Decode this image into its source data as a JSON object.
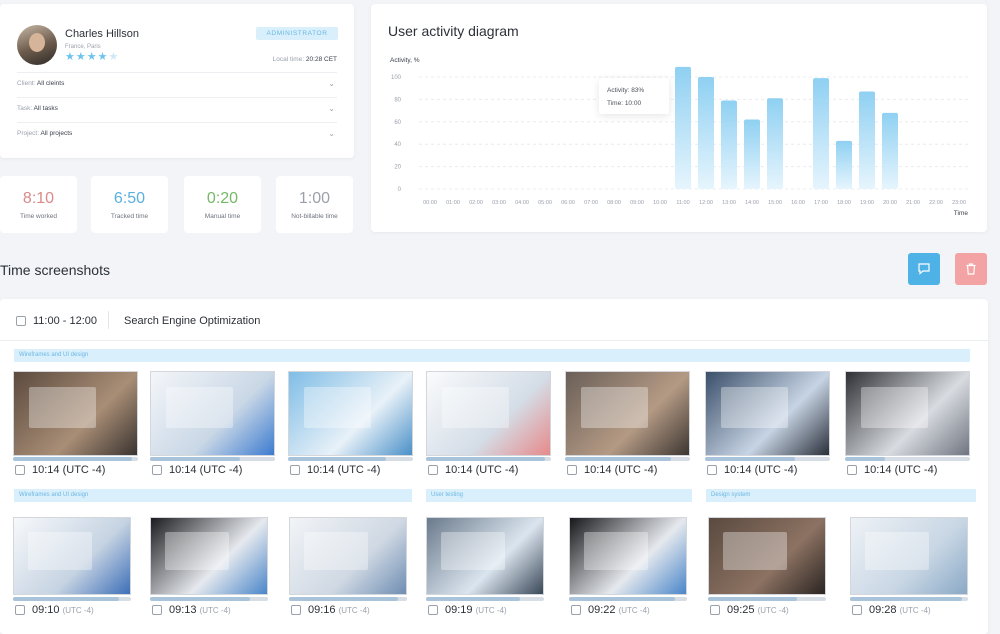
{
  "profile": {
    "name": "Charles Hillson",
    "location": "France, Paris",
    "rating": 4,
    "rating_max": 5,
    "badge": "ADMINISTRATOR",
    "local_time_label": "Local time:",
    "local_time_value": "20:28 CET",
    "filters": [
      {
        "label": "Client:",
        "value": "All cleints"
      },
      {
        "label": "Task:",
        "value": "All tasks"
      },
      {
        "label": "Project:",
        "value": "All projects"
      }
    ]
  },
  "stats": [
    {
      "value": "8:10",
      "label": "Time worked",
      "color": "#d98a8a"
    },
    {
      "value": "6:50",
      "label": "Tracked time",
      "color": "#5bb0dd"
    },
    {
      "value": "0:20",
      "label": "Manual time",
      "color": "#77b86a"
    },
    {
      "value": "1:00",
      "label": "Not-billable time",
      "color": "#9aa1ab"
    }
  ],
  "chart_data": {
    "type": "bar",
    "title": "User activity diagram",
    "ylabel": "Activity, %",
    "xlabel": "Time",
    "ylim": [
      0,
      100
    ],
    "yticks": [
      0,
      20,
      40,
      60,
      80,
      100
    ],
    "categories": [
      "00:00",
      "01:00",
      "02:00",
      "03:00",
      "04:00",
      "05:00",
      "06:00",
      "07:00",
      "08:00",
      "09:00",
      "10:00",
      "11:00",
      "12:00",
      "13:00",
      "14:00",
      "15:00",
      "16:00",
      "17:00",
      "18:00",
      "19:00",
      "20:00",
      "21:00",
      "22:00",
      "23:00"
    ],
    "values": [
      0,
      0,
      0,
      0,
      0,
      0,
      0,
      0,
      0,
      0,
      0,
      109,
      100,
      79,
      62,
      81,
      0,
      99,
      43,
      87,
      68,
      0,
      0,
      0
    ],
    "tooltip": {
      "activity": "Activity: 83%",
      "time": "Time: 10:00"
    },
    "grid": true,
    "bar_color": "#8fd0f2"
  },
  "screenshots": {
    "title": "Time screenshots",
    "comment_icon": "comment-icon",
    "delete_icon": "trash-icon",
    "period": "11:00 - 12:00",
    "project": "Search Engine Optimization",
    "groups": [
      {
        "label": "Wireframes and UI design"
      },
      {
        "label": "Wireframes and UI design"
      },
      {
        "label": "User testing"
      },
      {
        "label": "Design system"
      }
    ],
    "row1": [
      {
        "time": "10:14 (UTC -4)",
        "progress": 0.95
      },
      {
        "time": "10:14 (UTC -4)",
        "progress": 0.72
      },
      {
        "time": "10:14 (UTC -4)",
        "progress": 0.78
      },
      {
        "time": "10:14 (UTC -4)",
        "progress": 0.95
      },
      {
        "time": "10:14 (UTC -4)",
        "progress": 0.85
      },
      {
        "time": "10:14 (UTC -4)",
        "progress": 0.72
      },
      {
        "time": "10:14 (UTC -4)",
        "progress": 0.32
      }
    ],
    "row2": [
      {
        "time": "09:10",
        "tz": "(UTC -4)",
        "progress": 0.9
      },
      {
        "time": "09:13",
        "tz": "(UTC -4)",
        "progress": 0.85
      },
      {
        "time": "09:16",
        "tz": "(UTC -4)",
        "progress": 0.92
      },
      {
        "time": "09:19",
        "tz": "(UTC -4)",
        "progress": 0.8
      },
      {
        "time": "09:22",
        "tz": "(UTC -4)",
        "progress": 0.9
      },
      {
        "time": "09:25",
        "tz": "(UTC -4)",
        "progress": 0.75
      },
      {
        "time": "09:28",
        "tz": "(UTC -4)",
        "progress": 0.95
      }
    ]
  }
}
